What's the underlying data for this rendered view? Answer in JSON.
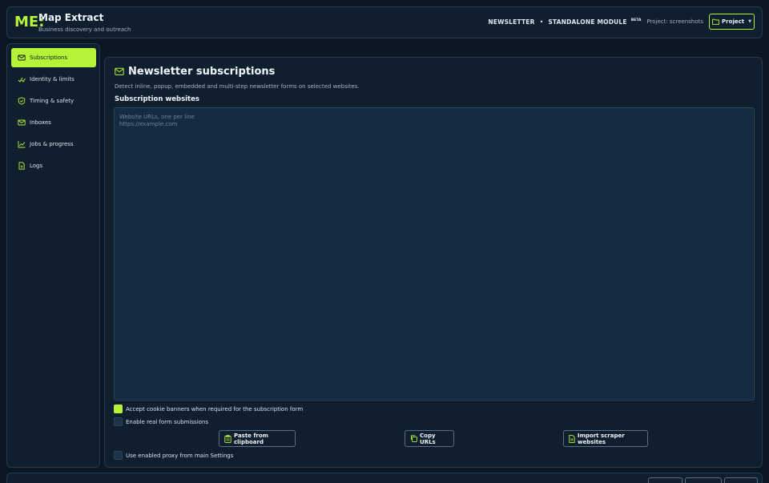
{
  "header": {
    "logo": "ME:",
    "title": "Map Extract",
    "subtitle": "Business discovery and outreach",
    "module": "NEWSLETTER",
    "separator": "•",
    "standalone": "STANDALONE MODULE",
    "beta": "BETA",
    "project_text": "Project: screenshots",
    "project_button": "Project"
  },
  "sidebar": {
    "items": [
      {
        "label": "Subscriptions",
        "icon": "mail-icon",
        "active": true
      },
      {
        "label": "Identity & limits",
        "icon": "user-check-icon",
        "active": false
      },
      {
        "label": "Timing & safety",
        "icon": "shield-icon",
        "active": false
      },
      {
        "label": "Inboxes",
        "icon": "mail-icon",
        "active": false
      },
      {
        "label": "Jobs & progress",
        "icon": "chart-icon",
        "active": false
      },
      {
        "label": "Logs",
        "icon": "file-icon",
        "active": false
      }
    ]
  },
  "main": {
    "title": "Newsletter subscriptions",
    "description": "Detect inline, popup, embedded and multi-step newsletter forms on selected websites.",
    "section_label": "Subscription websites",
    "urls_placeholder": "Website URLs, one per line\nhttps://example.com",
    "urls_value": "",
    "options": {
      "accept_cookies": {
        "label": "Accept cookie banners when required for the subscription form",
        "checked": true
      },
      "real_submissions": {
        "label": "Enable real form submissions",
        "checked": false
      },
      "use_proxy": {
        "label": "Use enabled proxy from main Settings",
        "checked": false
      }
    },
    "buttons": {
      "paste": "Paste from clipboard",
      "copy": "Copy URLs",
      "import": "Import scraper websites"
    }
  },
  "colors": {
    "accent": "#b7f23a",
    "background": "#0b1722",
    "panel": "#0f1f2e"
  }
}
